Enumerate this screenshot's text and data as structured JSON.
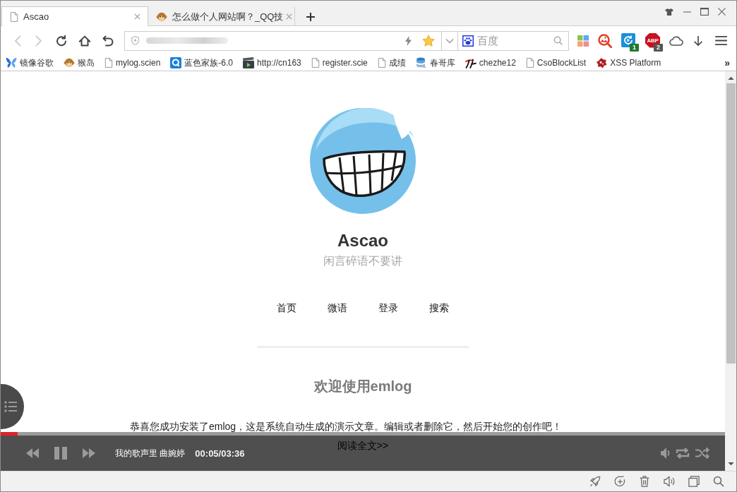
{
  "tabs": [
    {
      "title": "Ascao",
      "kind": "page",
      "selected": true
    },
    {
      "title": "怎么做个人网站啊？_QQ技",
      "kind": "monkey",
      "selected": false
    }
  ],
  "nav_buttons": [
    {
      "kind": "back",
      "disabled": true
    },
    {
      "kind": "forward",
      "disabled": true
    },
    {
      "kind": "reload",
      "disabled": false
    },
    {
      "kind": "home",
      "disabled": false
    },
    {
      "kind": "undo",
      "disabled": false
    }
  ],
  "search": {
    "placeholder": "百度"
  },
  "extensions": [
    {
      "kind": "apps"
    },
    {
      "kind": "image-search"
    },
    {
      "kind": "sync",
      "badge": "1"
    },
    {
      "kind": "adblock",
      "label": "ABP",
      "badge": "2"
    },
    {
      "kind": "cloud"
    },
    {
      "kind": "download"
    },
    {
      "kind": "menu"
    }
  ],
  "bookmarks": [
    {
      "label": "镜像谷歌",
      "kind": "butterfly"
    },
    {
      "label": "猴岛",
      "kind": "monkey"
    },
    {
      "label": "mylog.scien",
      "kind": "page"
    },
    {
      "label": "蓝色家族-6.0",
      "kind": "q"
    },
    {
      "label": "http://cn163",
      "kind": "film"
    },
    {
      "label": "register.scie",
      "kind": "page"
    },
    {
      "label": "成绩",
      "kind": "page"
    },
    {
      "label": "春哥库",
      "kind": "database"
    },
    {
      "label": "chezhe12",
      "kind": "brush"
    },
    {
      "label": "CsoBlockList",
      "kind": "page"
    },
    {
      "label": "XSS Platform",
      "kind": "splat"
    }
  ],
  "bookmarks_more": "»",
  "page": {
    "title": "Ascao",
    "tagline": "闲言碎语不要讲",
    "nav": [
      "首页",
      "微语",
      "登录",
      "搜索"
    ],
    "post": {
      "title": "欢迎使用emlog",
      "excerpt": "恭喜您成功安装了emlog，这是系统自动生成的演示文章。编辑或者删除它，然后开始您的创作吧！",
      "more": "阅读全文>>"
    }
  },
  "player": {
    "song": "我的歌声里 曲婉婷",
    "time": "00:05/03:36",
    "playing": true,
    "progress": {
      "level": 0.023
    }
  }
}
